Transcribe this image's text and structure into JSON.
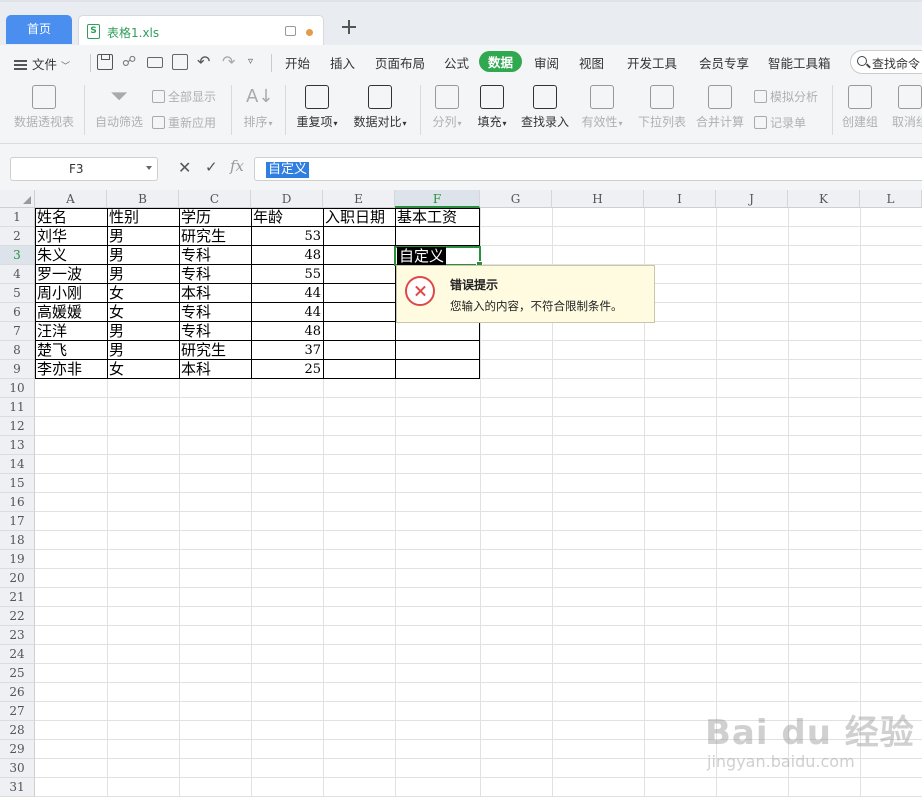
{
  "tabs": {
    "home": "首页",
    "file": "表格1.xls"
  },
  "menu": {
    "file": "文件",
    "items": [
      "开始",
      "插入",
      "页面布局",
      "公式",
      "数据",
      "审阅",
      "视图",
      "开发工具",
      "会员专享",
      "智能工具箱"
    ],
    "active": "数据",
    "search": "查找命令"
  },
  "ribbon": {
    "pivot": "数据透视表",
    "autofilter": "自动筛选",
    "show_all": "全部显示",
    "reapply": "重新应用",
    "sort": "排序",
    "duplicates": "重复项",
    "compare": "数据对比",
    "split": "分列",
    "fill": "填充",
    "lookup": "查找录入",
    "validity": "有效性",
    "dropdown": "下拉列表",
    "consolidate": "合并计算",
    "simulate": "模拟分析",
    "record": "记录单",
    "group": "创建组",
    "ungroup": "取消组"
  },
  "formula_bar": {
    "name_box": "F3",
    "value": "自定义",
    "fx": "fx"
  },
  "grid": {
    "columns": [
      "A",
      "B",
      "C",
      "D",
      "E",
      "F",
      "G",
      "H",
      "I",
      "J",
      "K",
      "L"
    ],
    "rows": [
      "1",
      "2",
      "3",
      "4",
      "5",
      "6",
      "7",
      "8",
      "9",
      "10",
      "11",
      "12",
      "13",
      "14",
      "15",
      "16",
      "17",
      "18",
      "19",
      "20",
      "21",
      "22",
      "23",
      "24",
      "25",
      "26",
      "27",
      "28",
      "29",
      "30",
      "31"
    ],
    "header": [
      "姓名",
      "性别",
      "学历",
      "年龄",
      "入职日期",
      "基本工资"
    ],
    "data": [
      [
        "刘华",
        "男",
        "研究生",
        "53"
      ],
      [
        "朱义",
        "男",
        "专科",
        "48"
      ],
      [
        "罗一波",
        "男",
        "专科",
        "55"
      ],
      [
        "周小刚",
        "女",
        "本科",
        "44"
      ],
      [
        "高媛媛",
        "女",
        "专科",
        "44"
      ],
      [
        "汪洋",
        "男",
        "专科",
        "48"
      ],
      [
        "楚飞",
        "男",
        "研究生",
        "37"
      ],
      [
        "李亦非",
        "女",
        "本科",
        "25"
      ]
    ],
    "active_cell_text": "自定义"
  },
  "error_tip": {
    "title": "错误提示",
    "message": "您输入的内容，不符合限制条件。"
  },
  "watermark": {
    "brand": "Bai du 经验",
    "url": "jingyan.baidu.com"
  },
  "colors": {
    "accent_green": "#2fa84f",
    "home_tab": "#4a8ef0",
    "error_red": "#e04848"
  }
}
